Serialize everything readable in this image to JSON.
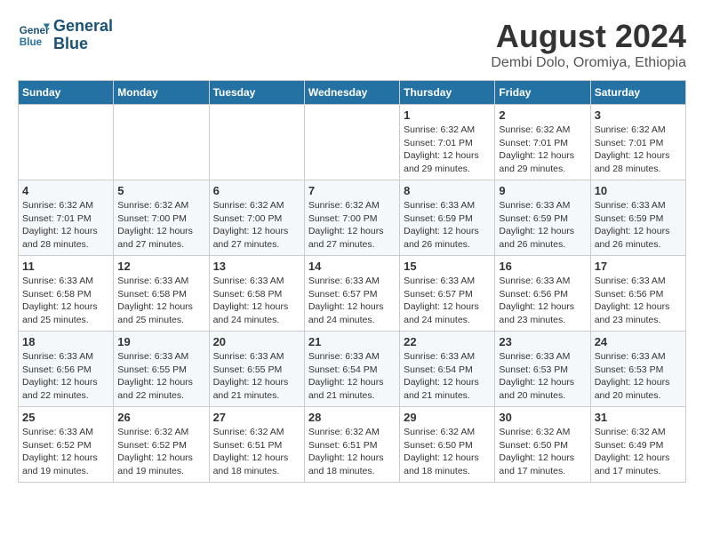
{
  "logo": {
    "line1": "General",
    "line2": "Blue"
  },
  "title": "August 2024",
  "location": "Dembi Dolo, Oromiya, Ethiopia",
  "days_of_week": [
    "Sunday",
    "Monday",
    "Tuesday",
    "Wednesday",
    "Thursday",
    "Friday",
    "Saturday"
  ],
  "weeks": [
    [
      {
        "day": "",
        "info": ""
      },
      {
        "day": "",
        "info": ""
      },
      {
        "day": "",
        "info": ""
      },
      {
        "day": "",
        "info": ""
      },
      {
        "day": "1",
        "info": "Sunrise: 6:32 AM\nSunset: 7:01 PM\nDaylight: 12 hours\nand 29 minutes."
      },
      {
        "day": "2",
        "info": "Sunrise: 6:32 AM\nSunset: 7:01 PM\nDaylight: 12 hours\nand 29 minutes."
      },
      {
        "day": "3",
        "info": "Sunrise: 6:32 AM\nSunset: 7:01 PM\nDaylight: 12 hours\nand 28 minutes."
      }
    ],
    [
      {
        "day": "4",
        "info": "Sunrise: 6:32 AM\nSunset: 7:01 PM\nDaylight: 12 hours\nand 28 minutes."
      },
      {
        "day": "5",
        "info": "Sunrise: 6:32 AM\nSunset: 7:00 PM\nDaylight: 12 hours\nand 27 minutes."
      },
      {
        "day": "6",
        "info": "Sunrise: 6:32 AM\nSunset: 7:00 PM\nDaylight: 12 hours\nand 27 minutes."
      },
      {
        "day": "7",
        "info": "Sunrise: 6:32 AM\nSunset: 7:00 PM\nDaylight: 12 hours\nand 27 minutes."
      },
      {
        "day": "8",
        "info": "Sunrise: 6:33 AM\nSunset: 6:59 PM\nDaylight: 12 hours\nand 26 minutes."
      },
      {
        "day": "9",
        "info": "Sunrise: 6:33 AM\nSunset: 6:59 PM\nDaylight: 12 hours\nand 26 minutes."
      },
      {
        "day": "10",
        "info": "Sunrise: 6:33 AM\nSunset: 6:59 PM\nDaylight: 12 hours\nand 26 minutes."
      }
    ],
    [
      {
        "day": "11",
        "info": "Sunrise: 6:33 AM\nSunset: 6:58 PM\nDaylight: 12 hours\nand 25 minutes."
      },
      {
        "day": "12",
        "info": "Sunrise: 6:33 AM\nSunset: 6:58 PM\nDaylight: 12 hours\nand 25 minutes."
      },
      {
        "day": "13",
        "info": "Sunrise: 6:33 AM\nSunset: 6:58 PM\nDaylight: 12 hours\nand 24 minutes."
      },
      {
        "day": "14",
        "info": "Sunrise: 6:33 AM\nSunset: 6:57 PM\nDaylight: 12 hours\nand 24 minutes."
      },
      {
        "day": "15",
        "info": "Sunrise: 6:33 AM\nSunset: 6:57 PM\nDaylight: 12 hours\nand 24 minutes."
      },
      {
        "day": "16",
        "info": "Sunrise: 6:33 AM\nSunset: 6:56 PM\nDaylight: 12 hours\nand 23 minutes."
      },
      {
        "day": "17",
        "info": "Sunrise: 6:33 AM\nSunset: 6:56 PM\nDaylight: 12 hours\nand 23 minutes."
      }
    ],
    [
      {
        "day": "18",
        "info": "Sunrise: 6:33 AM\nSunset: 6:56 PM\nDaylight: 12 hours\nand 22 minutes."
      },
      {
        "day": "19",
        "info": "Sunrise: 6:33 AM\nSunset: 6:55 PM\nDaylight: 12 hours\nand 22 minutes."
      },
      {
        "day": "20",
        "info": "Sunrise: 6:33 AM\nSunset: 6:55 PM\nDaylight: 12 hours\nand 21 minutes."
      },
      {
        "day": "21",
        "info": "Sunrise: 6:33 AM\nSunset: 6:54 PM\nDaylight: 12 hours\nand 21 minutes."
      },
      {
        "day": "22",
        "info": "Sunrise: 6:33 AM\nSunset: 6:54 PM\nDaylight: 12 hours\nand 21 minutes."
      },
      {
        "day": "23",
        "info": "Sunrise: 6:33 AM\nSunset: 6:53 PM\nDaylight: 12 hours\nand 20 minutes."
      },
      {
        "day": "24",
        "info": "Sunrise: 6:33 AM\nSunset: 6:53 PM\nDaylight: 12 hours\nand 20 minutes."
      }
    ],
    [
      {
        "day": "25",
        "info": "Sunrise: 6:33 AM\nSunset: 6:52 PM\nDaylight: 12 hours\nand 19 minutes."
      },
      {
        "day": "26",
        "info": "Sunrise: 6:32 AM\nSunset: 6:52 PM\nDaylight: 12 hours\nand 19 minutes."
      },
      {
        "day": "27",
        "info": "Sunrise: 6:32 AM\nSunset: 6:51 PM\nDaylight: 12 hours\nand 18 minutes."
      },
      {
        "day": "28",
        "info": "Sunrise: 6:32 AM\nSunset: 6:51 PM\nDaylight: 12 hours\nand 18 minutes."
      },
      {
        "day": "29",
        "info": "Sunrise: 6:32 AM\nSunset: 6:50 PM\nDaylight: 12 hours\nand 18 minutes."
      },
      {
        "day": "30",
        "info": "Sunrise: 6:32 AM\nSunset: 6:50 PM\nDaylight: 12 hours\nand 17 minutes."
      },
      {
        "day": "31",
        "info": "Sunrise: 6:32 AM\nSunset: 6:49 PM\nDaylight: 12 hours\nand 17 minutes."
      }
    ]
  ]
}
